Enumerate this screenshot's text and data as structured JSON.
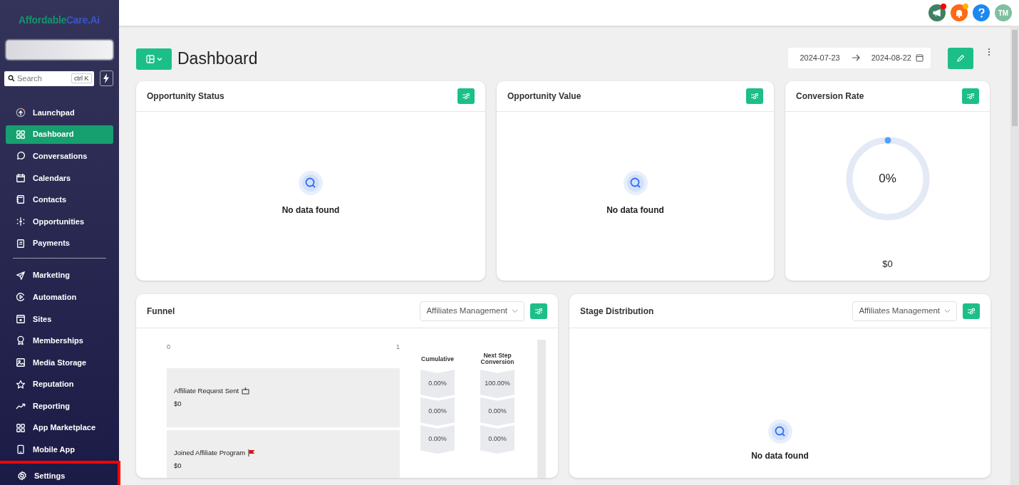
{
  "sidebar": {
    "logo": {
      "part_1": "Affordable",
      "part_2": "Care.Ai"
    },
    "search": {
      "placeholder": "Search",
      "shortcut": "ctrl K"
    },
    "sections": [
      [
        {
          "label": "Launchpad",
          "kind": "rocket",
          "selected": false
        },
        {
          "label": "Dashboard",
          "kind": "grid",
          "selected": true
        },
        {
          "label": "Conversations",
          "kind": "chat",
          "selected": false
        },
        {
          "label": "Calendars",
          "kind": "calendar",
          "selected": false
        },
        {
          "label": "Contacts",
          "kind": "book",
          "selected": false
        },
        {
          "label": "Opportunities",
          "kind": "nodes",
          "selected": false
        },
        {
          "label": "Payments",
          "kind": "receipt",
          "selected": false
        }
      ],
      [
        {
          "label": "Marketing",
          "kind": "send",
          "selected": false
        },
        {
          "label": "Automation",
          "kind": "play",
          "selected": false
        },
        {
          "label": "Sites",
          "kind": "window",
          "selected": false
        },
        {
          "label": "Memberships",
          "kind": "award",
          "selected": false
        },
        {
          "label": "Media Storage",
          "kind": "image",
          "selected": false
        },
        {
          "label": "Reputation",
          "kind": "star",
          "selected": false
        },
        {
          "label": "Reporting",
          "kind": "trend",
          "selected": false
        },
        {
          "label": "App Marketplace",
          "kind": "grid",
          "selected": false
        },
        {
          "label": "Mobile App",
          "kind": "phone",
          "selected": false
        }
      ]
    ],
    "settings": {
      "label": "Settings",
      "highlighted": true
    }
  },
  "topbar": {
    "avatar": "TM"
  },
  "page": {
    "title": "Dashboard",
    "date_from": "2024-07-23",
    "date_to": "2024-08-22"
  },
  "cards": [
    {
      "title": "Opportunity Status",
      "kind": "empty",
      "message": "No data found"
    },
    {
      "title": "Opportunity Value",
      "kind": "empty",
      "message": "No data found"
    },
    {
      "title": "Conversion Rate",
      "kind": "ring",
      "reading": "0%",
      "level": 0,
      "amount": "$0"
    }
  ],
  "funnel": {
    "title": "Funnel",
    "pipeline": "Affiliates Management",
    "axis_start": "0",
    "axis_end": "1",
    "column_1": "Cumulative",
    "column_2": "Next Step Conversion",
    "stages": [
      {
        "name": "Affiliate Request Sent",
        "kind": "tray",
        "amount": "$0"
      },
      {
        "name": "Joined Affiliate Program",
        "kind": "flag",
        "amount": "$0"
      }
    ],
    "cumulative": [
      "0.00%",
      "0.00%",
      "0.00%"
    ],
    "next_step": [
      "100.00%",
      "0.00%",
      "0.00%"
    ]
  },
  "stage_distribution": {
    "title": "Stage Distribution",
    "pipeline": "Affiliates Management",
    "message": "No data found"
  }
}
